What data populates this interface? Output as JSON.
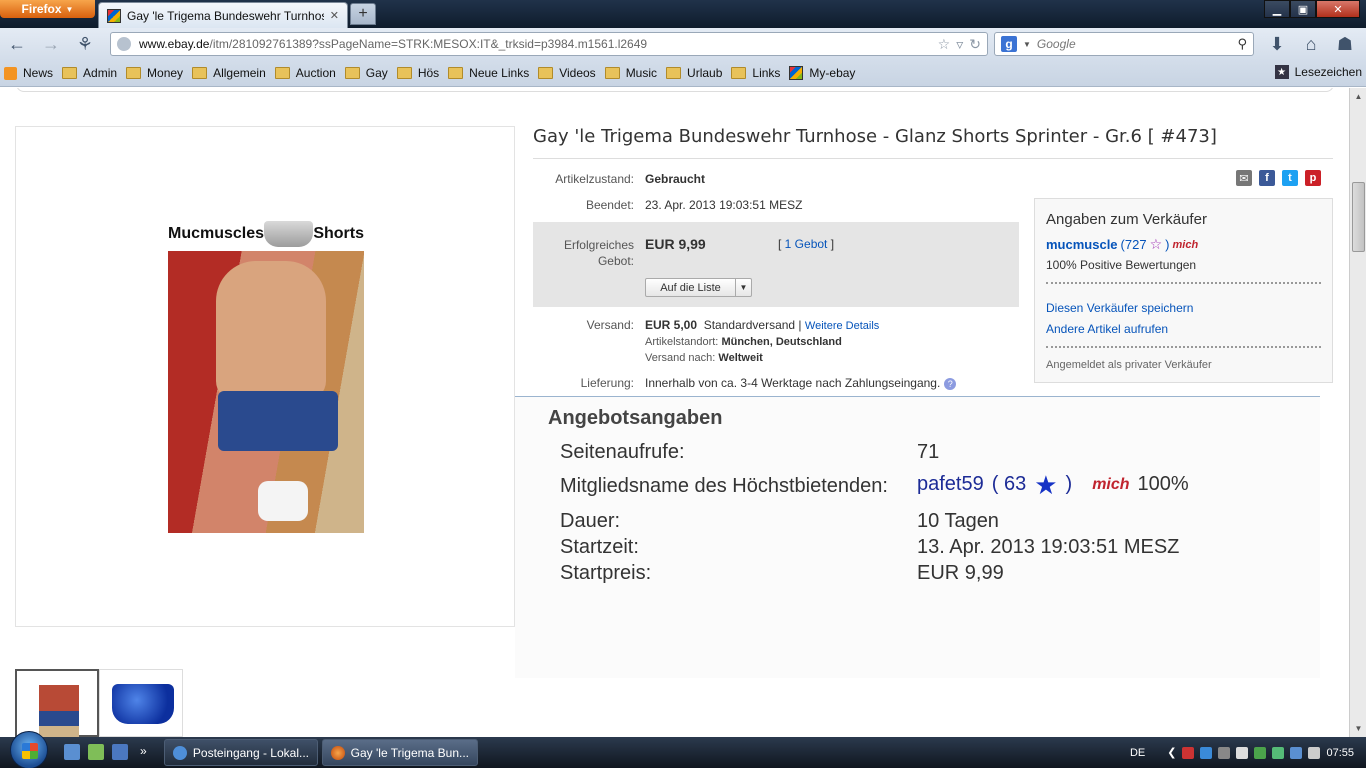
{
  "browser": {
    "app_button": "Firefox",
    "tab_title": "Gay 'le Trigema Bundeswehr Turnhose - ...",
    "new_tab": "+",
    "url_host": "www.ebay.de",
    "url_path": "/itm/281092761389?ssPageName=STRK:MESOX:IT&_trksid=p3984.m1561.l2649",
    "search_engine": "g",
    "search_placeholder": "Google",
    "bookmarks": [
      "News",
      "Admin",
      "Money",
      "Allgemein",
      "Auction",
      "Gay",
      "Hös",
      "Neue Links",
      "Videos",
      "Music",
      "Urlaub",
      "Links",
      "My-ebay"
    ],
    "bookmarks_menu": "Lesezeichen"
  },
  "listing": {
    "title": "Gay 'le Trigema Bundeswehr Turnhose - Glanz Shorts Sprinter - Gr.6 [ #473]",
    "image_logo_left": "Mucmuscles",
    "image_logo_right": "Shorts",
    "condition_label": "Artikelzustand:",
    "condition_value": "Gebraucht",
    "ended_label": "Beendet:",
    "ended_value": "23. Apr. 2013  19:03:51 MESZ",
    "winning_bid_label": "Erfolgreiches Gebot:",
    "winning_bid_value": "EUR 9,99",
    "bid_count_open": "[ ",
    "bid_count_link": "1 Gebot",
    "bid_count_close": " ]",
    "watch_button": "Auf die Liste",
    "shipping_label": "Versand:",
    "shipping_price": "EUR 5,00",
    "shipping_method": "Standardversand |",
    "shipping_details_link": "Weitere Details",
    "location_label": "Artikelstandort:",
    "location_value": "München, Deutschland",
    "ships_to_label": "Versand nach:",
    "ships_to_value": "Weltweit",
    "delivery_label": "Lieferung:",
    "delivery_value": "Innerhalb von ca. 3-4 Werktage nach Zahlungseingang.",
    "help_icon": "?"
  },
  "seller": {
    "heading": "Angaben zum Verkäufer",
    "name": "mucmuscle",
    "score_open": "(727",
    "score_close": ")",
    "badge": "mich",
    "positive": "100% Positive Bewertungen",
    "save_seller": "Diesen Verkäufer speichern",
    "other_items": "Andere Artikel aufrufen",
    "private": "Angemeldet als privater Verkäufer"
  },
  "offer_info": {
    "heading": "Angebotsangaben",
    "views_label": "Seitenaufrufe:",
    "views_value": "71",
    "top_bidder_label": "Mitgliedsname des Höchstbietenden:",
    "top_bidder_name": "pafet59",
    "top_bidder_score_open": "( 63",
    "top_bidder_score_close": ")",
    "top_bidder_badge": "mich",
    "top_bidder_percent": "100%",
    "duration_label": "Dauer:",
    "duration_value": "10 Tagen",
    "start_label": "Startzeit:",
    "start_value": "13. Apr. 2013 19:03:51 MESZ",
    "start_price_label": "Startpreis:",
    "start_price_value": "EUR 9,99"
  },
  "taskbar": {
    "more": "»",
    "task1": "Posteingang - Lokal...",
    "task2": "Gay 'le Trigema Bun...",
    "lang": "DE",
    "clock": "07:55"
  }
}
